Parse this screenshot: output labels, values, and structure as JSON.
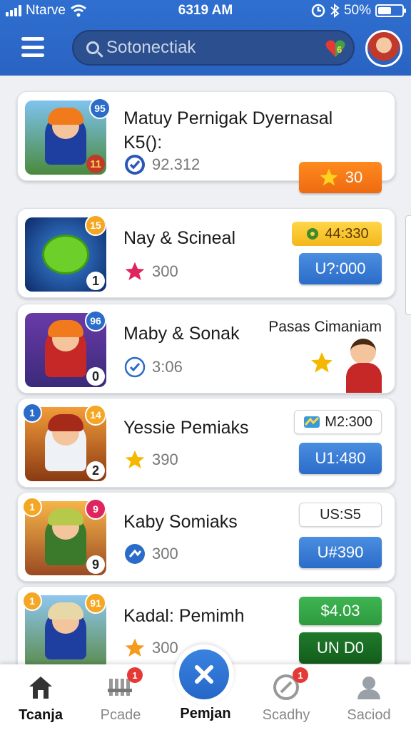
{
  "status_bar": {
    "carrier": "Ntarve",
    "time": "6319 AM",
    "battery": "50%",
    "battery_level": 0.5
  },
  "header": {
    "search_placeholder": "Sotonectiak",
    "search_badge": "6"
  },
  "games": [
    {
      "title": "Matuy Pernigak Dyernasal K5():",
      "corner": "95",
      "rank": "11",
      "meta": "92.312",
      "meta_icon": "check-badge-icon",
      "button": "30",
      "button_icon": "star-icon",
      "button_color": "orange"
    },
    {
      "title": "Nay & Scineal",
      "corner": "15",
      "rank": "1",
      "meta": "300",
      "meta_icon": "star-icon",
      "pill": "44:330",
      "pill_icon": "gear-icon",
      "button": "U?:000",
      "button_color": "blue"
    },
    {
      "title": "Maby & Sonak",
      "corner": "96",
      "rank": "0",
      "meta": "3:06",
      "meta_icon": "check-circle-icon",
      "side_text": "Pasas Cimaniam"
    },
    {
      "title": "Yessie Pemiaks",
      "corner": "14",
      "left_corner": "1",
      "rank": "2",
      "meta": "390",
      "meta_icon": "star-icon",
      "pill": "M2:300",
      "pill_icon": "map-icon",
      "button": "U1:480",
      "button_color": "blue"
    },
    {
      "title": "Kaby Somiaks",
      "corner": "9",
      "left_corner": "1",
      "rank": "9",
      "meta": "300",
      "meta_icon": "send-icon",
      "pill": "US:S5",
      "button": "U#390",
      "button_color": "blue"
    },
    {
      "title": "Kadal: Pemimh",
      "corner": "91",
      "left_corner": "1",
      "rank": "",
      "meta": "300",
      "meta_icon": "star-icon",
      "pill": "$4.03",
      "pill_color": "green",
      "button": "UN D0",
      "button_color": "darkgreen"
    }
  ],
  "nav": {
    "items": [
      {
        "label": "Tcanja",
        "icon": "home-icon",
        "active": true
      },
      {
        "label": "Pcade",
        "icon": "grid-icon",
        "badge": "1"
      },
      {
        "label": "Pemjan",
        "icon": "close-icon"
      },
      {
        "label": "Scadhy",
        "icon": "compass-icon",
        "badge": "1"
      },
      {
        "label": "Saciod",
        "icon": "person-icon"
      }
    ]
  },
  "colors": {
    "header": "#2f6fd0",
    "accent_blue": "#2b6cc9",
    "orange": "#ee6a10",
    "green": "#2e9a3f",
    "star": "#f5b800"
  }
}
